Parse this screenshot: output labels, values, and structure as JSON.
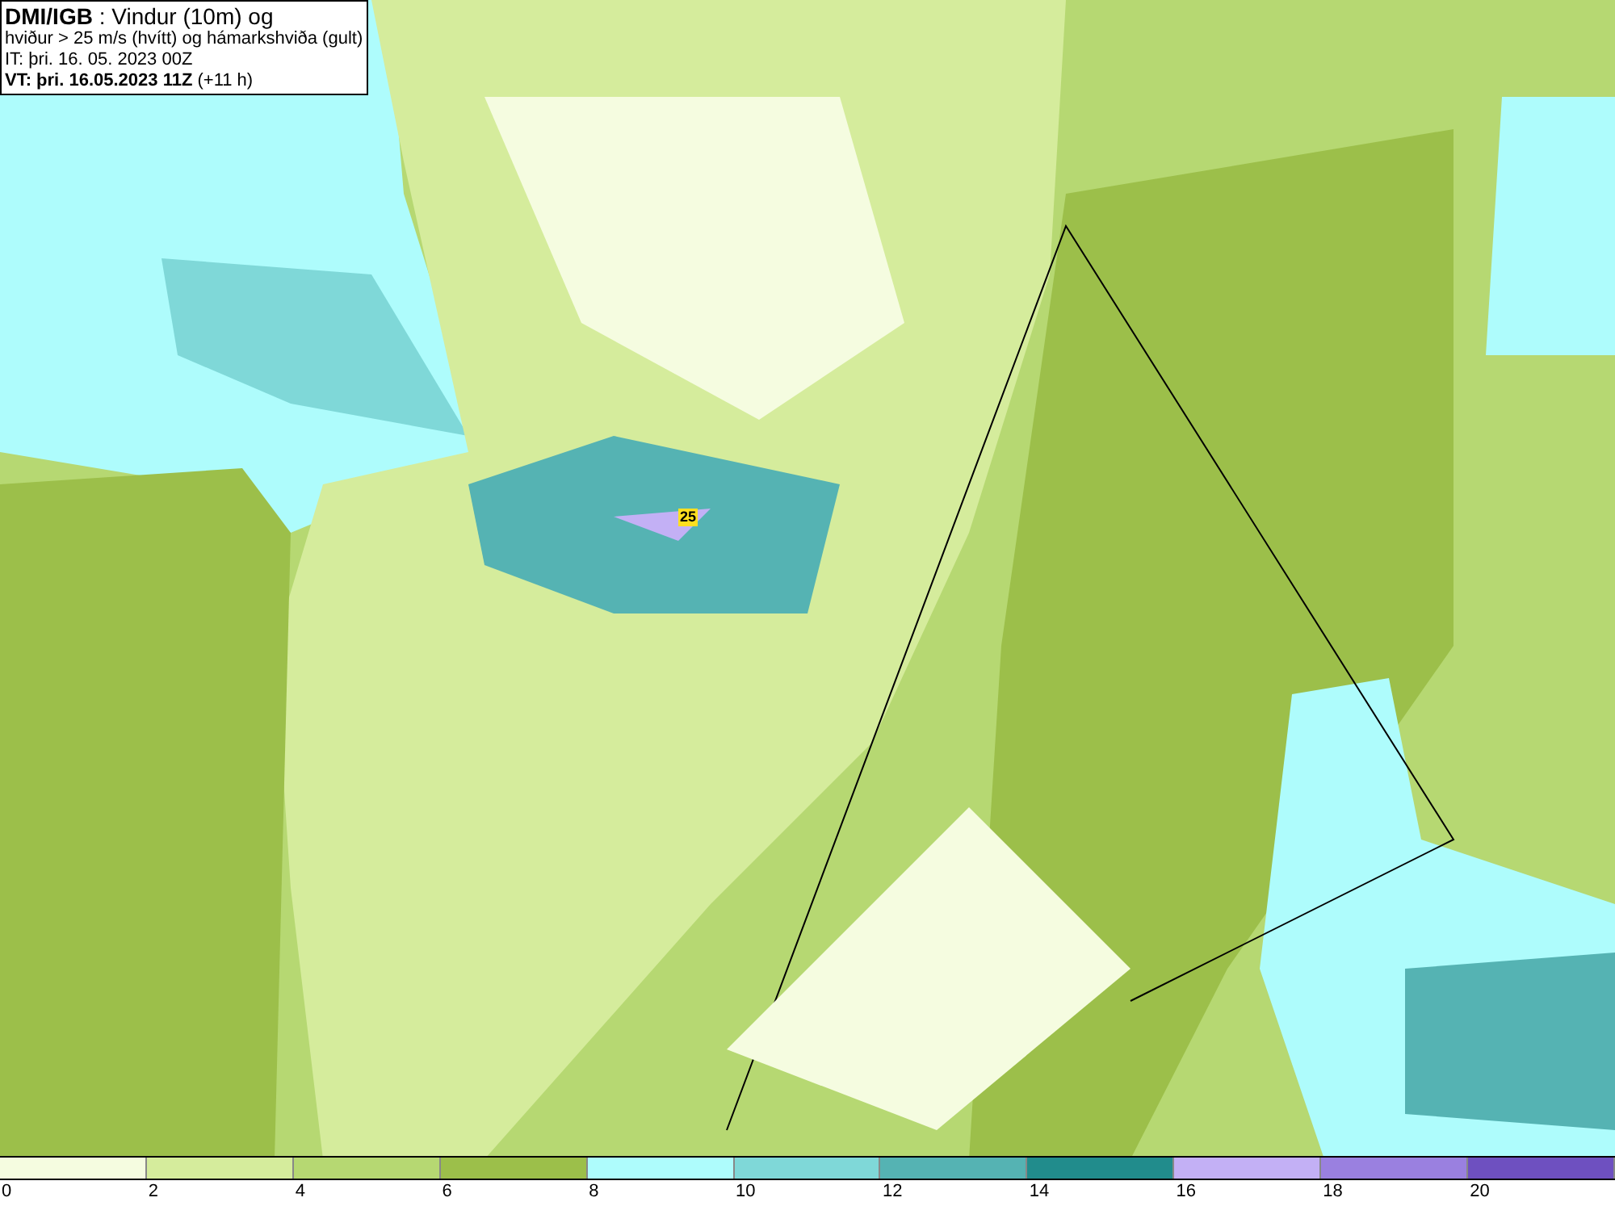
{
  "header": {
    "lines": [
      "**DMI/IGB** : Vindur (10m) og",
      "hviður > 25 m/s (hvítt) og hámarkshviða (gult)",
      "IT: þri. 16. 05. 2023 00Z",
      "**VT: þri. 16.05.2023 11Z** (+11 h)"
    ]
  },
  "map": {
    "gust_markers": [
      {
        "value": "25"
      }
    ]
  },
  "legend": {
    "bins": [
      {
        "color": "#f5fce0"
      },
      {
        "color": "#d5ec9c"
      },
      {
        "color": "#b6d872"
      },
      {
        "color": "#9cbf4a"
      },
      {
        "color": "#aefcfc"
      },
      {
        "color": "#7fd8d8"
      },
      {
        "color": "#55b3b3"
      },
      {
        "color": "#218c8c"
      },
      {
        "color": "#c3b0f5"
      },
      {
        "color": "#9a80e0"
      },
      {
        "color": "#6e50c0"
      }
    ],
    "ticks": [
      "0",
      "2",
      "4",
      "6",
      "8",
      "10",
      "12",
      "14",
      "16",
      "18",
      "20"
    ]
  }
}
